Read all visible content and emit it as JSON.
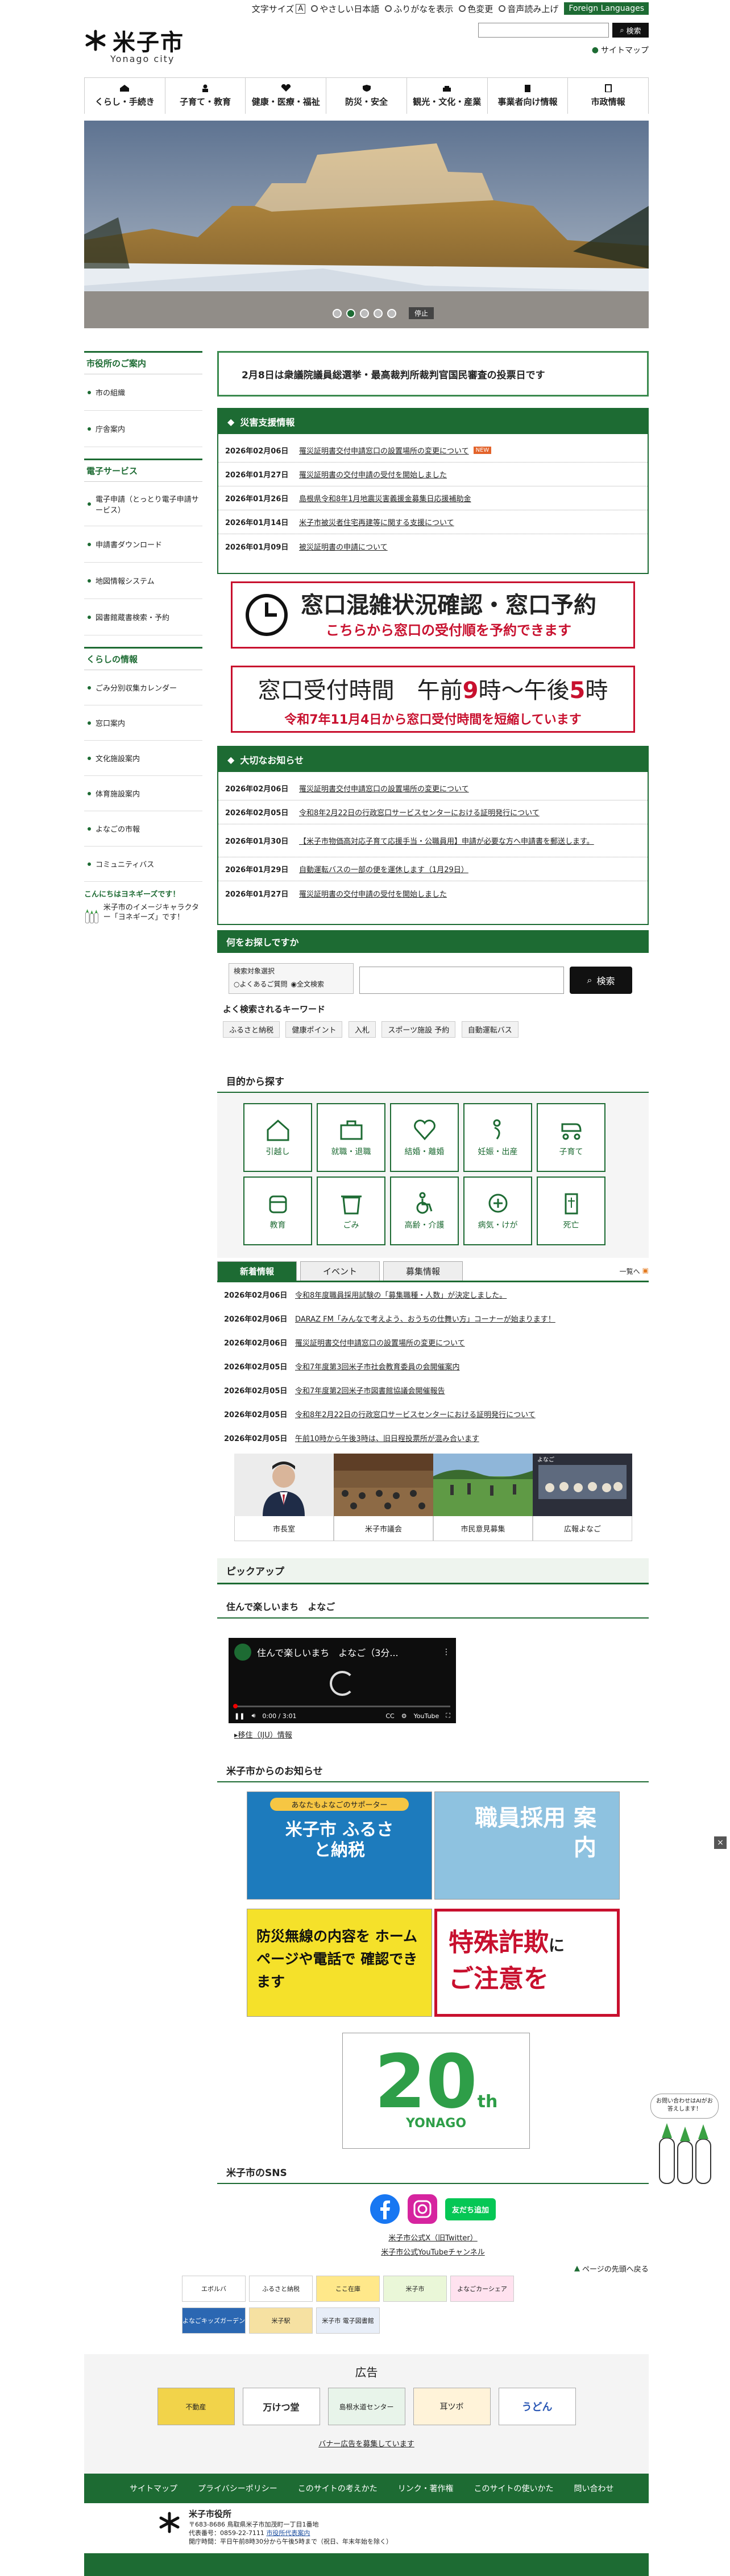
{
  "header": {
    "logo_text": "米子市",
    "logo_en": "Yonago city",
    "util": {
      "font_size_label": "文字サイズ",
      "font_size_btn": "A",
      "items": [
        "やさしい日本語",
        "ふりがなを表示",
        "色変更",
        "音声読み上げ"
      ],
      "lang_btn": "Foreign Languages"
    },
    "search_btn": "検索",
    "sitemap": "サイトマップ",
    "nav": [
      "くらし・手続き",
      "子育て・教育",
      "健康・医療・福祉",
      "防災・安全",
      "観光・文化・産業",
      "事業者向け情報",
      "市政情報"
    ]
  },
  "hero": {
    "stop_label": "停止",
    "slides": 5,
    "active": 1
  },
  "side": {
    "sections": [
      {
        "title": "市役所のご案内",
        "items": [
          "市の組織",
          "庁舎案内"
        ]
      },
      {
        "title": "電子サービス",
        "items": [
          "電子申請（とっとり電子申請サービス）",
          "申請書ダウンロード",
          "地図情報システム",
          "図書館蔵書検索・予約"
        ]
      },
      {
        "title": "くらしの情報",
        "items": [
          "ごみ分別収集カレンダー",
          "窓口案内",
          "文化施設案内",
          "体育施設案内",
          "よなごの市報",
          "コミュニティバス"
        ]
      }
    ],
    "mascot_title": "こんにちはヨネギーズです！",
    "mascot_text": "米子市のイメージキャラクター「ヨネギーズ」です！"
  },
  "notice": "2月8日は衆議院議員総選挙・最高裁判所裁判官国民審査の投票日です",
  "disaster": {
    "title": "災害支援情報",
    "items": [
      {
        "date": "2026年02月06日",
        "text": "罹災証明書交付申請窓口の設置場所の変更について",
        "badge": "NEW"
      },
      {
        "date": "2026年01月27日",
        "text": "罹災証明書の交付申請の受付を開始しました"
      },
      {
        "date": "2026年01月26日",
        "text": "島根県令和8年1月地震災害義援金募集日応援補助金"
      },
      {
        "date": "2026年01月14日",
        "text": "米子市被災者住宅再建等に関する支援について"
      },
      {
        "date": "2026年01月09日",
        "text": "被災証明書の申請について"
      }
    ]
  },
  "banner_congestion": {
    "title": "窓口混雑状況確認・窓口予約",
    "sub": "こちらから窓口の受付順を予約できます"
  },
  "banner_hours": {
    "title_pre": "窓口受付時間　午前",
    "h1": "9",
    "title_mid": "時〜午後",
    "h2": "5",
    "title_post": "時",
    "sub": "令和7年11月4日から窓口受付時間を短縮しています"
  },
  "important": {
    "title": "大切なお知らせ",
    "items": [
      {
        "date": "2026年02月06日",
        "text": "罹災証明書交付申請窓口の設置場所の変更について"
      },
      {
        "date": "2026年02月05日",
        "text": "令和8年2月22日の行政窓口サービスセンターにおける証明発行について"
      },
      {
        "date": "2026年01月30日",
        "text": "【米子市物価高対応子育て応援手当・公職員用】申請が必要な方へ申請書を郵送します。"
      },
      {
        "date": "2026年01月29日",
        "text": "自動運転バスの一部の便を運休します（1月29日）"
      },
      {
        "date": "2026年01月27日",
        "text": "罹災証明書の交付申請の受付を開始しました"
      }
    ]
  },
  "search": {
    "title": "何をお探しですか",
    "option_label": "検索対象選択",
    "opt1": "よくあるご質問",
    "opt2": "全文検索",
    "btn": "検索",
    "kw_title": "よく検索されるキーワード",
    "keywords": [
      "ふるさと納税",
      "健康ポイント",
      "入札",
      "スポーツ施設 予約",
      "自動運転バス"
    ]
  },
  "purpose": {
    "title": "目的から探す",
    "items": [
      "引越し",
      "就職・退職",
      "結婚・離婚",
      "妊娠・出産",
      "子育て",
      "教育",
      "ごみ",
      "高齢・介護",
      "病気・けが",
      "死亡"
    ]
  },
  "tabs": {
    "items": [
      "新着情報",
      "イベント",
      "募集情報"
    ],
    "active": 0,
    "more": "一覧へ",
    "news": [
      {
        "date": "2026年02月06日",
        "text": "令和8年度職員採用試験の「募集職種・人数」が決定しました。"
      },
      {
        "date": "2026年02月06日",
        "text": "DARAZ FM「みんなで考えよう、おうちの仕舞い方」コーナーが始まります！"
      },
      {
        "date": "2026年02月06日",
        "text": "罹災証明書交付申請窓口の設置場所の変更について"
      },
      {
        "date": "2026年02月05日",
        "text": "令和7年度第3回米子市社会教育委員の会開催案内"
      },
      {
        "date": "2026年02月05日",
        "text": "令和7年度第2回米子市図書館協議会開催報告"
      },
      {
        "date": "2026年02月05日",
        "text": "令和8年2月22日の行政窓口サービスセンターにおける証明発行について"
      },
      {
        "date": "2026年02月05日",
        "text": "午前10時から午後3時は、旧日程投票所が混み合います"
      }
    ]
  },
  "thumbs": [
    "市長室",
    "米子市議会",
    "市民意見募集",
    "広報よなご"
  ],
  "pickup": {
    "title": "ピックアップ",
    "sub": "住んで楽しいまち　よなご",
    "video_title": "住んで楽しいまち　よなご（3分...",
    "video_time": "0:00 / 3:01",
    "link": "移住（IJU）情報"
  },
  "oshirase": {
    "title": "米子市からのお知らせ",
    "b1_top": "あなたもよなごのサポーター",
    "b1": "米子市 ふるさと納税",
    "b2": "職員採用 案内",
    "b3": "防災無線の内容を ホームページや電話で 確認できます",
    "b4_a": "特殊詐欺",
    "b4_b": "に",
    "b4_c": "ご注意を",
    "b5_big": "20",
    "b5_th": "th",
    "b5_town": "YONAGO"
  },
  "sns": {
    "title": "米子市のSNS",
    "line_label": "友だち追加",
    "link1": "米子市公式X（旧Twitter）",
    "link2": "米子市公式YouTubeチャンネル"
  },
  "pagetop": "ページの先頭へ戻る",
  "small_banners": [
    "エボルバ",
    "ふるさと納税",
    "ここ在庫",
    "米子市",
    "よなごカーシェア",
    "よなごキッズガーデン",
    "米子駅",
    "米子市 電子図書館"
  ],
  "ad": {
    "title": "広告",
    "banners": [
      "不動産",
      "万けつ堂",
      "島根水道センター",
      "耳ツボ",
      "うどん"
    ],
    "link": "バナー広告を募集しています"
  },
  "footer": {
    "nav": [
      "サイトマップ",
      "プライバシーポリシー",
      "このサイトの考えかた",
      "リンク・著作権",
      "このサイトの使いかた",
      "問い合わせ"
    ],
    "org": "米子市役所",
    "addr": "〒683-8686 鳥取県米子市加茂町一丁目1番地",
    "tel_label": "代表番号：0859-22-7111",
    "tel_link": "市役所代表案内",
    "hours": "開庁時間：平日午前8時30分から午後5時まで（祝日、年末年始を除く）"
  },
  "float": {
    "label": "お問い合わせはAIがお答えします！"
  },
  "colors": {
    "accent": "#1d6b33",
    "red": "#c8102e"
  }
}
